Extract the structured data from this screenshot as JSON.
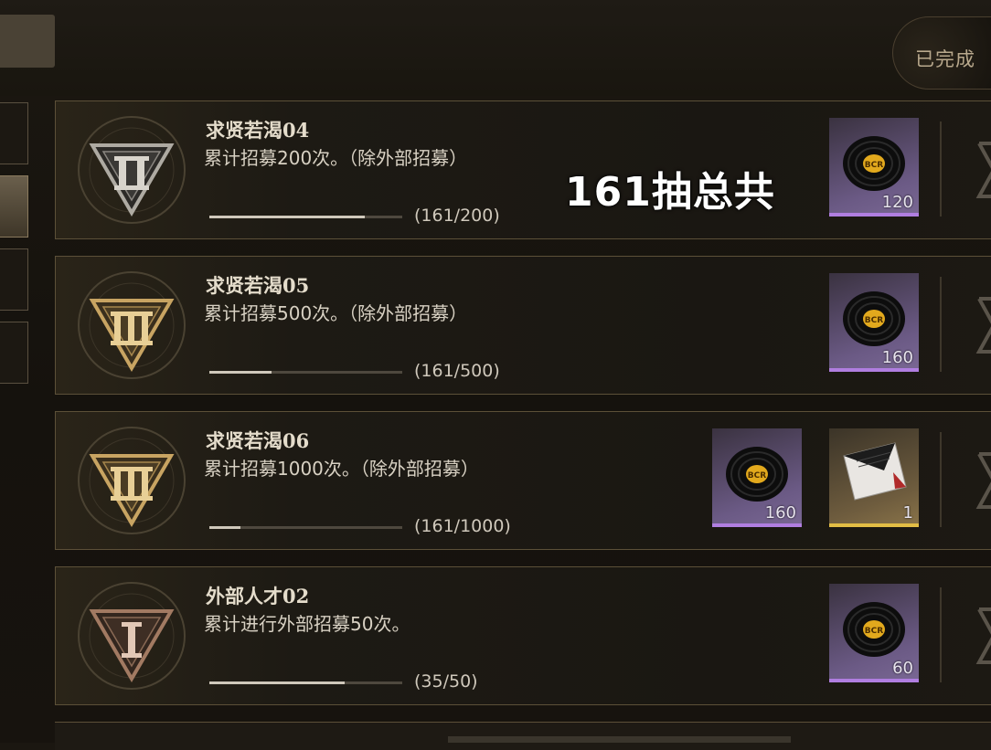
{
  "header": {
    "completed_label": "已完成"
  },
  "overlay": {
    "text": "161抽总共"
  },
  "tasks": [
    {
      "title": "求贤若渴04",
      "description": "累计招募200次。（除外部招募）",
      "progress_text": "(161/200)",
      "progress": 0.805,
      "emblem": "tier-2-triangle-emblem",
      "rewards": [
        {
          "icon": "record-disc-icon",
          "qty": "120",
          "rarity_color": "#b07ee0"
        }
      ]
    },
    {
      "title": "求贤若渴05",
      "description": "累计招募500次。（除外部招募）",
      "progress_text": "(161/500)",
      "progress": 0.322,
      "emblem": "tier-3-triangle-emblem",
      "rewards": [
        {
          "icon": "record-disc-icon",
          "qty": "160",
          "rarity_color": "#b07ee0"
        }
      ]
    },
    {
      "title": "求贤若渴06",
      "description": "累计招募1000次。（除外部招募）",
      "progress_text": "(161/1000)",
      "progress": 0.161,
      "emblem": "tier-3-triangle-emblem",
      "rewards": [
        {
          "icon": "record-disc-icon",
          "qty": "160",
          "rarity_color": "#b07ee0"
        },
        {
          "icon": "envelope-ticket-icon",
          "qty": "1",
          "rarity_color": "#e2bd45"
        }
      ]
    },
    {
      "title": "外部人才02",
      "description": "累计进行外部招募50次。",
      "progress_text": "(35/50)",
      "progress": 0.7,
      "emblem": "tier-1-triangle-emblem",
      "rewards": [
        {
          "icon": "record-disc-icon",
          "qty": "60",
          "rarity_color": "#b07ee0"
        }
      ]
    }
  ]
}
